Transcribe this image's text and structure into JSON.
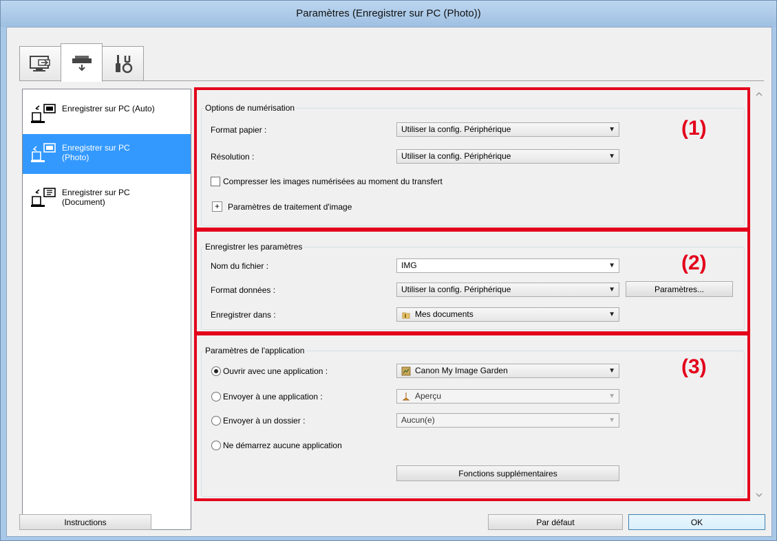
{
  "window": {
    "title": "Paramètres (Enregistrer sur PC (Photo))"
  },
  "tabs": [
    {
      "icon": "scan-from-computer-icon"
    },
    {
      "icon": "scan-from-panel-icon"
    },
    {
      "icon": "general-settings-tools-icon"
    }
  ],
  "sidebar": {
    "items": [
      {
        "label": "Enregistrer sur PC (Auto)",
        "selected": false
      },
      {
        "label": "Enregistrer sur PC (Photo)",
        "selected": true
      },
      {
        "label": "Enregistrer sur PC (Document)",
        "selected": false
      }
    ]
  },
  "scan_options": {
    "title": "Options de numérisation",
    "paper_size_label": "Format papier :",
    "paper_size_value": "Utiliser la config. Périphérique",
    "resolution_label": "Résolution :",
    "resolution_value": "Utiliser la config. Périphérique",
    "compress_label": "Compresser les images numérisées au moment du transfert",
    "compress_checked": false,
    "image_processing_label": "Paramètres de traitement d'image",
    "badge": "(1)"
  },
  "save_settings": {
    "title": "Enregistrer les paramètres",
    "file_name_label": "Nom du fichier :",
    "file_name_value": "IMG",
    "data_format_label": "Format données :",
    "data_format_value": "Utiliser la config. Périphérique",
    "settings_button": "Paramètres...",
    "save_in_label": "Enregistrer dans :",
    "save_in_value": "Mes documents",
    "badge": "(2)"
  },
  "app_settings": {
    "title": "Paramètres de l'application",
    "open_app_label": "Ouvrir avec une application :",
    "open_app_value": "Canon My Image Garden",
    "send_app_label": "Envoyer à une application :",
    "send_app_value": "Aperçu",
    "send_folder_label": "Envoyer à un dossier :",
    "send_folder_value": "Aucun(e)",
    "no_app_label": "Ne démarrez aucune application",
    "selected_option": "open_app",
    "more_functions_button": "Fonctions supplémentaires",
    "badge": "(3)"
  },
  "footer": {
    "instructions_button": "Instructions",
    "default_button": "Par défaut",
    "ok_button": "OK"
  },
  "colors": {
    "highlight": "#e3001b",
    "selection": "#3399ff"
  }
}
